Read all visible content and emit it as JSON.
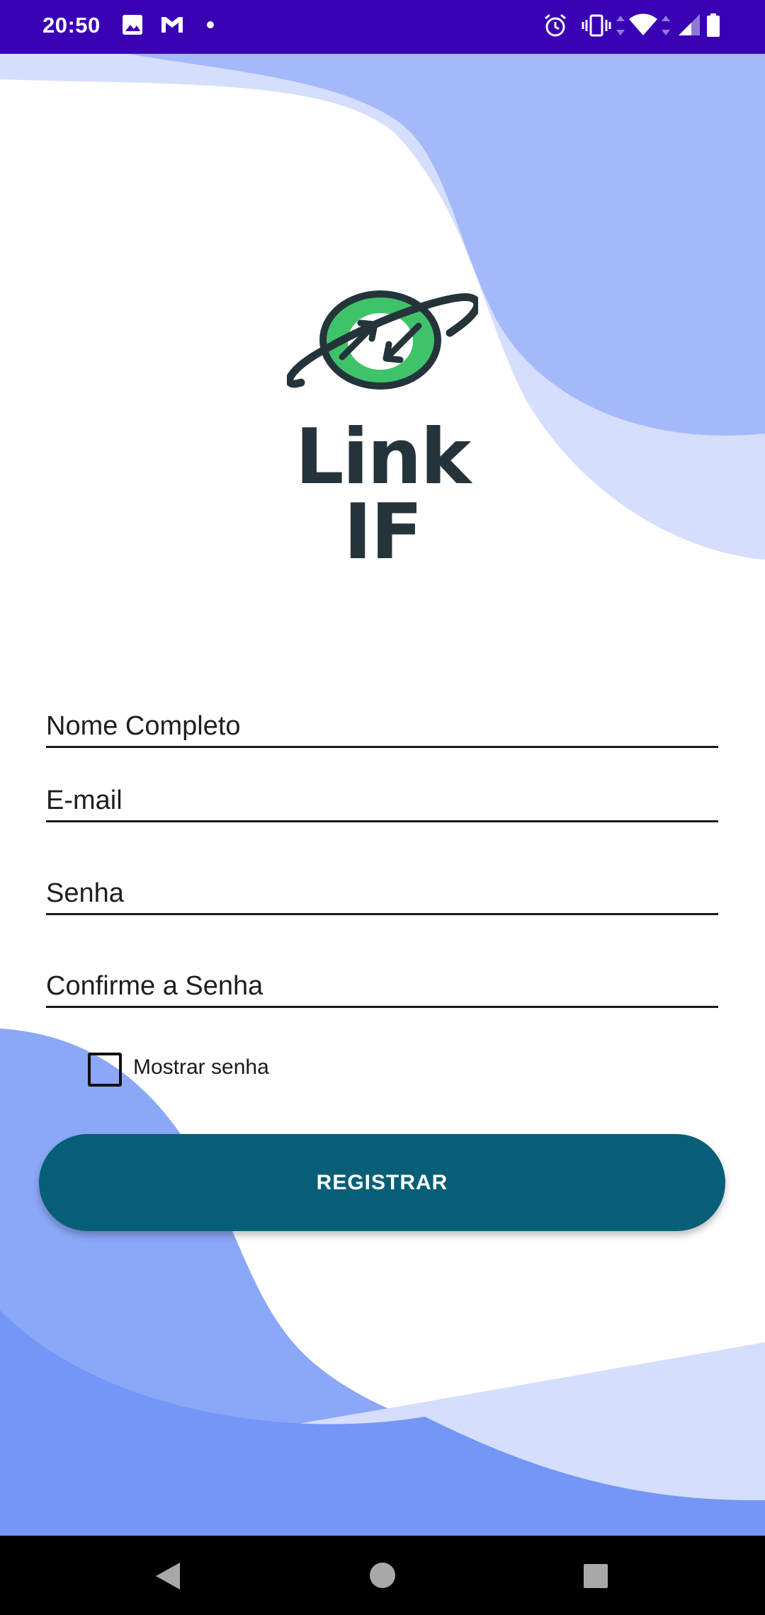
{
  "status_bar": {
    "time": "20:50",
    "left_icons": [
      "image-icon",
      "gmail-icon",
      "dot-icon"
    ],
    "right_icons": [
      "alarm-icon",
      "vibrate-icon",
      "data-arrows-icon",
      "wifi-icon",
      "signal-icon",
      "battery-icon"
    ],
    "background": "#3a00b4"
  },
  "logo": {
    "line1": "Link",
    "line2": "IF",
    "colors": {
      "planet": "#3fc36a",
      "ring": "#25343a"
    }
  },
  "form": {
    "full_name_placeholder": "Nome Completo",
    "email_placeholder": "E-mail",
    "password_placeholder": "Senha",
    "confirm_password_placeholder": "Confirme a Senha",
    "show_password_label": "Mostrar senha",
    "show_password_checked": false
  },
  "register_button": {
    "label": "REGISTRAR",
    "color": "#065f76"
  },
  "nav_bar": {
    "icons": [
      "back-icon",
      "home-icon",
      "recents-icon"
    ]
  },
  "theme": {
    "wave_light": "#d5defd",
    "wave_mid": "#a4b9fa",
    "wave_dark": "#7396f7"
  }
}
